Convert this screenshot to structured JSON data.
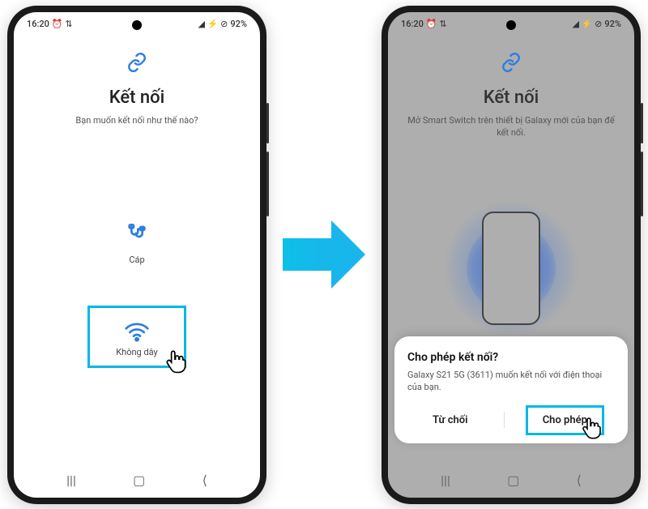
{
  "status": {
    "time": "16:20",
    "icons_left": "⏰ ⇅",
    "icons_right": "◢ ⚡ ⊘",
    "battery": "92%"
  },
  "left": {
    "title": "Kết nối",
    "subtitle": "Bạn muốn kết nối như thế nào?",
    "cable_label": "Cáp",
    "wireless_label": "Không dây"
  },
  "right": {
    "title": "Kết nối",
    "subtitle": "Mở Smart Switch trên thiết bị Galaxy mới của bạn để kết nối.",
    "dialog": {
      "title": "Cho phép kết nối?",
      "body": "Galaxy S21 5G (3611) muốn kết nối với điện thoại của bạn.",
      "decline": "Từ chối",
      "allow": "Cho phép"
    }
  },
  "nav": {
    "recent": "|||",
    "home": "▢",
    "back": "⟨"
  }
}
